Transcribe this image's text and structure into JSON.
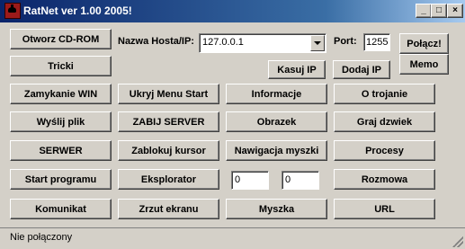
{
  "window": {
    "title": "RatNet ver 1.00 2005!"
  },
  "controls": {
    "minimize": "_",
    "maximize": "□",
    "close": "×"
  },
  "host": {
    "label": "Nazwa Hosta/IP:",
    "value": "127.0.0.1"
  },
  "port": {
    "label": "Port:",
    "value": "1255"
  },
  "buttons": {
    "otworz_cdrom": "Otworz CD-ROM",
    "tricki": "Tricki",
    "polacz": "Połącz!",
    "memo": "Memo",
    "kasuj_ip": "Kasuj IP",
    "dodaj_ip": "Dodaj IP",
    "zamykanie_win": "Zamykanie WIN",
    "ukryj_menu_start": "Ukryj Menu Start",
    "informacje": "Informacje",
    "o_trojanie": "O trojanie",
    "wyslij_plik": "Wyślij plik",
    "zabij_server": "ZABIJ SERVER",
    "obrazek": "Obrazek",
    "graj_dzwiek": "Graj dzwiek",
    "serwer": "SERWER",
    "zablokuj_kursor": "Zablokuj kursor",
    "nawigacja_myszki": "Nawigacja myszki",
    "procesy": "Procesy",
    "start_programu": "Start programu",
    "eksplorator": "Eksplorator",
    "rozmowa": "Rozmowa",
    "komunikat": "Komunikat",
    "zrzut_ekranu": "Zrzut ekranu",
    "myszka": "Myszka",
    "url": "URL"
  },
  "coords": {
    "x": "0",
    "y": "0"
  },
  "status": {
    "text": "Nie połączony"
  }
}
